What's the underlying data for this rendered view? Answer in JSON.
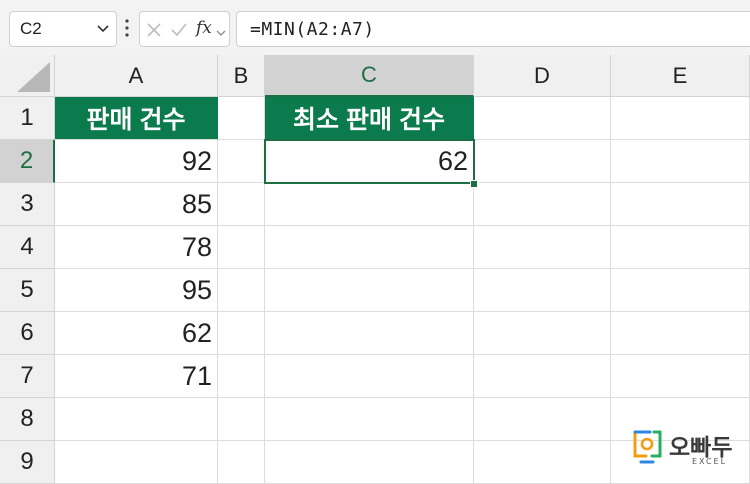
{
  "formula_bar": {
    "name_box": "C2",
    "fx_label": "fx",
    "formula": "=MIN(A2:A7)"
  },
  "columns": [
    "A",
    "B",
    "C",
    "D",
    "E"
  ],
  "rows": [
    "1",
    "2",
    "3",
    "4",
    "5",
    "6",
    "7",
    "8",
    "9"
  ],
  "cells": {
    "A1": "판매 건수",
    "A2": "92",
    "A3": "85",
    "A4": "78",
    "A5": "95",
    "A6": "62",
    "A7": "71",
    "C1": "최소 판매 건수",
    "C2": "62"
  },
  "selection": {
    "cell": "C2",
    "column": "C",
    "row": "2"
  },
  "logo": {
    "name": "오빠두",
    "sub": "EXCEL"
  },
  "colors": {
    "header_fill": "#0b7a4d",
    "selection": "#1f6e43",
    "logo_orange": "#f39c12",
    "logo_blue": "#2e86de",
    "logo_green": "#27ae60"
  }
}
